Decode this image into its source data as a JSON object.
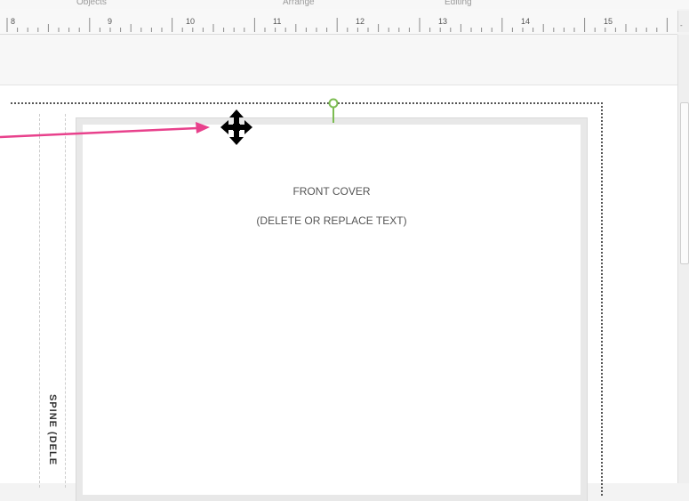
{
  "ribbon": {
    "groups": [
      "Objects",
      "Arrange",
      "Editing"
    ]
  },
  "ruler": {
    "labels": [
      "8",
      "9",
      "10",
      "11",
      "12",
      "13",
      "14",
      "15"
    ],
    "end_label": "-"
  },
  "cover": {
    "title": "FRONT COVER",
    "subtitle": "(DELETE OR REPLACE TEXT)"
  },
  "spine": {
    "label": "SPINE (DELE"
  },
  "icons": {
    "move_cursor": "move-cursor-icon",
    "rotation_handle": "rotation-handle-icon",
    "annotation_arrow": "annotation-arrow-icon"
  },
  "colors": {
    "arrow": "#e8418c",
    "rotation_handle": "#7cbc52",
    "cursor": "#000000"
  }
}
